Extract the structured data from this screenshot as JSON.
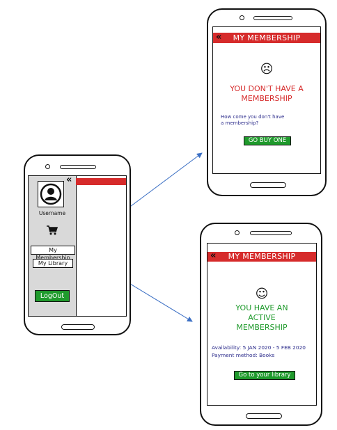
{
  "menu_phone": {
    "back_icon": "«",
    "username": "Username",
    "cart_icon": "shopping-cart",
    "my_membership_button": "My Membership",
    "my_library_button": "My Library",
    "logout_button": "LogOut"
  },
  "no_membership_phone": {
    "back_icon": "«",
    "title": "MY MEMBERSHIP",
    "face_icon": "☹",
    "heading_line1": "YOU DON'T HAVE A",
    "heading_line2": "MEMBERSHIP",
    "question_line1": "How come you don't have",
    "question_line2": "a membership?",
    "buy_button": "GO BUY ONE"
  },
  "active_membership_phone": {
    "back_icon": "«",
    "title": "MY MEMBERSHIP",
    "face_icon": "☺",
    "heading_line1": "YOU HAVE AN",
    "heading_line2": "ACTIVE",
    "heading_line3": "MEMBERSHIP",
    "availability": "Availability: 5 JAN 2020 - 5 FEB 2020",
    "payment": "Payment method: Books",
    "library_button": "Go to your library"
  },
  "colors": {
    "accent_red": "#d62b2b",
    "button_green": "#1f9a2c",
    "heading_red": "#d62b2b",
    "heading_green": "#1f9a2c",
    "info_blue": "#2a2a8a",
    "arrow_blue": "#3b6fc4",
    "drawer_gray": "#d9d9d9"
  }
}
